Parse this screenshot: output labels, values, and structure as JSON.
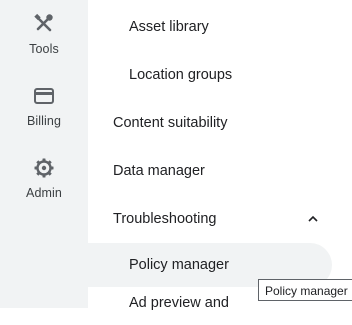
{
  "nav_rail": {
    "items": [
      {
        "label": "Tools",
        "icon": "tools-icon"
      },
      {
        "label": "Billing",
        "icon": "credit-card-icon"
      },
      {
        "label": "Admin",
        "icon": "gear-icon"
      }
    ]
  },
  "menu": {
    "asset_library": "Asset library",
    "location_groups": "Location groups",
    "content_suitability": "Content suitability",
    "data_manager": "Data manager",
    "troubleshooting": "Troubleshooting",
    "policy_manager": "Policy manager",
    "ad_preview": "Ad preview and"
  },
  "tooltip": {
    "text": "Policy manager"
  },
  "colors": {
    "rail_bg": "#f1f3f4",
    "hover_bg": "#f1f3f4",
    "icon": "#5f6368",
    "text": "#202124"
  }
}
